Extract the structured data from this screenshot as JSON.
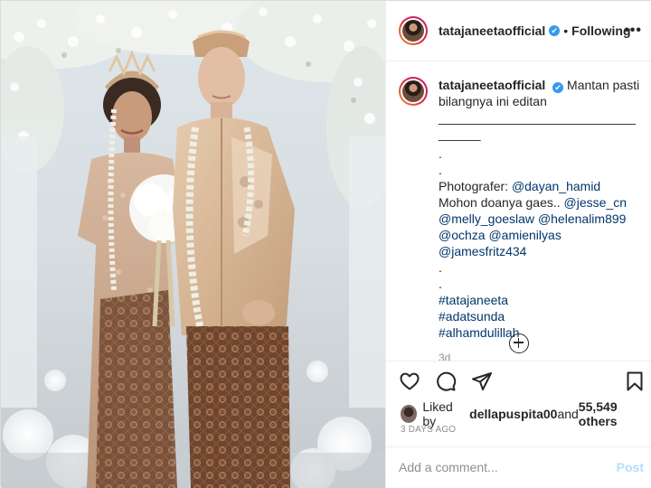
{
  "header": {
    "username": "tatajaneetaofficial",
    "verified": "✔",
    "separator": "•",
    "follow_state": "Following",
    "more": "•••"
  },
  "caption": {
    "username": "tatajaneetaofficial",
    "lines": [
      "Mantan pasti",
      "bilangnya ini editan",
      "____________________________",
      "______",
      ".",
      ".",
      "Photografer: ",
      "Mohon doanya gaes.. ",
      "",
      "",
      ".",
      ".",
      "",
      "",
      ""
    ],
    "mentions": {
      "dayan_hamid": "@dayan_hamid",
      "jesse_cn": "@jesse_cn",
      "melly_goeslaw": "@melly_goeslaw",
      "helenalim899": "@helenalim899",
      "ochza": "@ochza",
      "amienilyas": "@amienilyas",
      "jamesfritz434": "@jamesfritz434"
    },
    "hashtags": [
      "#tatajaneeta",
      "#adatsunda",
      "#alhamdulillah"
    ],
    "age": "3d"
  },
  "likes": {
    "prefix": "Liked by ",
    "first_user": "dellapuspita00",
    "middle": " and ",
    "others": "55,549 others"
  },
  "date": "3 DAYS AGO",
  "comment": {
    "placeholder": "Add a comment...",
    "post_label": "Post"
  },
  "colors": {
    "link": "#00376b",
    "verified": "#3897f0",
    "post_disabled": "#b2dffc",
    "muted": "#8e8e8e"
  },
  "icons": [
    "more-icon",
    "verified-icon",
    "add-comment-icon",
    "heart-icon",
    "comment-icon",
    "share-icon",
    "save-icon"
  ]
}
